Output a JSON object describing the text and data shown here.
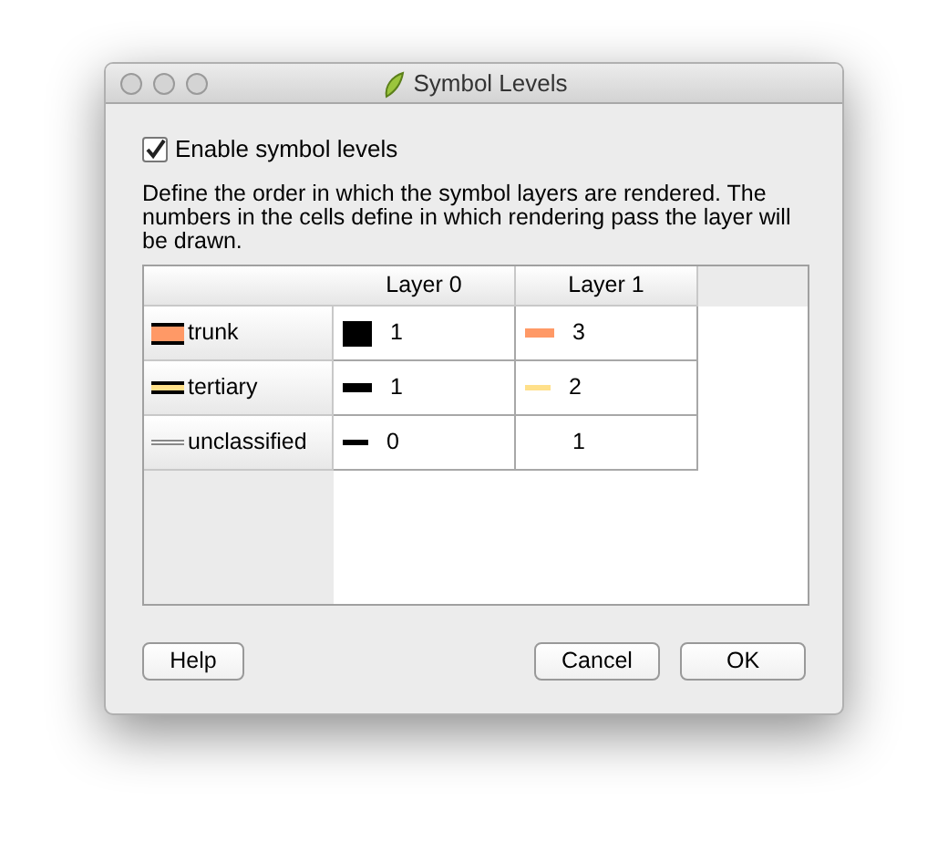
{
  "window": {
    "title": "Symbol Levels"
  },
  "enable_checkbox": {
    "label": "Enable symbol levels",
    "checked": true
  },
  "description": "Define the order in which the symbol layers are rendered. The numbers in the cells define in which rendering pass the layer will be drawn.",
  "table": {
    "columns": [
      "Layer 0",
      "Layer 1"
    ],
    "rows": [
      {
        "label": "trunk",
        "kind": "wide",
        "color": "#ff9966",
        "cells": [
          {
            "kind": "block",
            "color": "#000000",
            "value": "1"
          },
          {
            "kind": "bar",
            "color": "#ff9966",
            "value": "3"
          }
        ]
      },
      {
        "label": "tertiary",
        "kind": "medium",
        "color": "#ffe08a",
        "cells": [
          {
            "kind": "bar",
            "color": "#000000",
            "value": "1"
          },
          {
            "kind": "line",
            "color": "#ffe08a",
            "value": "2"
          }
        ]
      },
      {
        "label": "unclassified",
        "kind": "thin",
        "color": "#ffffff",
        "cells": [
          {
            "kind": "line",
            "color": "#000000",
            "value": "0"
          },
          {
            "kind": "none",
            "value": "1"
          }
        ]
      }
    ]
  },
  "buttons": [
    {
      "label": "Help",
      "kind": "help"
    },
    {
      "label": "Cancel",
      "kind": "cancel"
    },
    {
      "label": "OK",
      "kind": "ok"
    }
  ]
}
